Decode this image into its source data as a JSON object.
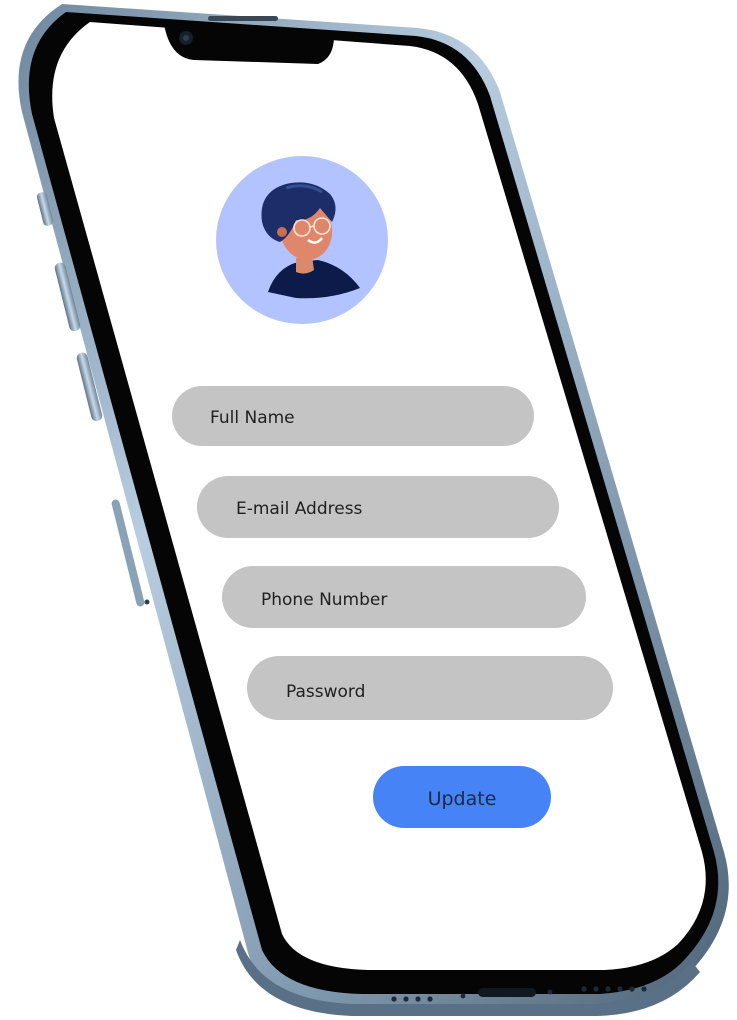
{
  "form": {
    "fields": [
      {
        "label": "Full Name",
        "type": "text"
      },
      {
        "label": "E-mail Address",
        "type": "email"
      },
      {
        "label": "Phone Number",
        "type": "tel"
      },
      {
        "label": "Password",
        "type": "password"
      }
    ],
    "submit_label": "Update"
  },
  "avatar": {
    "icon": "user-avatar-icon"
  },
  "colors": {
    "field_bg": "#c4c4c4",
    "button_bg": "#4583f7",
    "avatar_bg": "#b2c3ff",
    "frame": "#8aa4bd"
  }
}
